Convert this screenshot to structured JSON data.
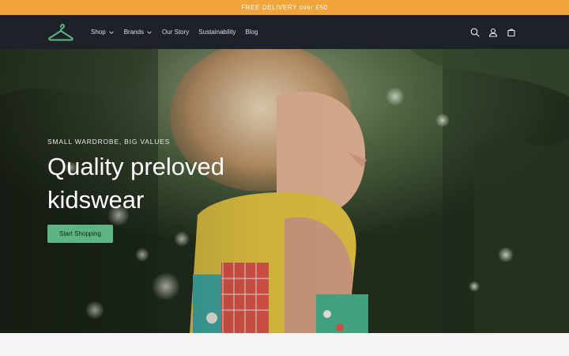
{
  "announcement": {
    "text": "FREE DELIVERY over £50"
  },
  "header": {
    "logo_icon": "hanger-icon",
    "nav": [
      {
        "label": "Shop",
        "has_dropdown": true
      },
      {
        "label": "Brands",
        "has_dropdown": true
      },
      {
        "label": "Our Story",
        "has_dropdown": false
      },
      {
        "label": "Sustainability",
        "has_dropdown": false
      },
      {
        "label": "Blog",
        "has_dropdown": false
      }
    ],
    "icons": [
      "search-icon",
      "account-icon",
      "cart-icon"
    ]
  },
  "hero": {
    "eyebrow": "SMALL WARDROBE, BIG VALUES",
    "headline": "Quality preloved kidswear",
    "cta_label": "Start Shopping"
  },
  "colors": {
    "announcement_bg": "#f0a43a",
    "header_bg": "#1d2229",
    "accent": "#5fb485"
  }
}
